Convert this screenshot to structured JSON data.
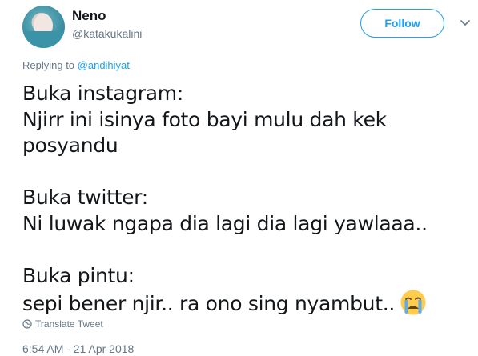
{
  "author": {
    "display_name": "Neno",
    "screen_name": "@katakukalini",
    "avatar_icon": "avatar-photo"
  },
  "actions": {
    "follow_label": "Follow",
    "more_icon": "chevron-down-icon"
  },
  "reply_context": {
    "prefix": "Replying to ",
    "handle": "@andihiyat"
  },
  "tweet": {
    "lines": [
      "Buka instagram:",
      "Njirr ini isinya foto bayi mulu dah kek",
      "posyandu",
      "",
      "Buka twitter:",
      "Ni luwak ngapa dia lagi dia lagi yawlaaa..",
      "",
      "Buka pintu:",
      "sepi bener njir.. ra ono sing nyambut.."
    ],
    "emoji": "loudly-crying-face"
  },
  "translate": {
    "label": "Translate Tweet",
    "icon": "globe-icon"
  },
  "timestamp": "6:54 AM - 21 Apr 2018",
  "colors": {
    "accent": "#1da1f2",
    "secondary_text": "#657786",
    "primary_text": "#14171a"
  }
}
